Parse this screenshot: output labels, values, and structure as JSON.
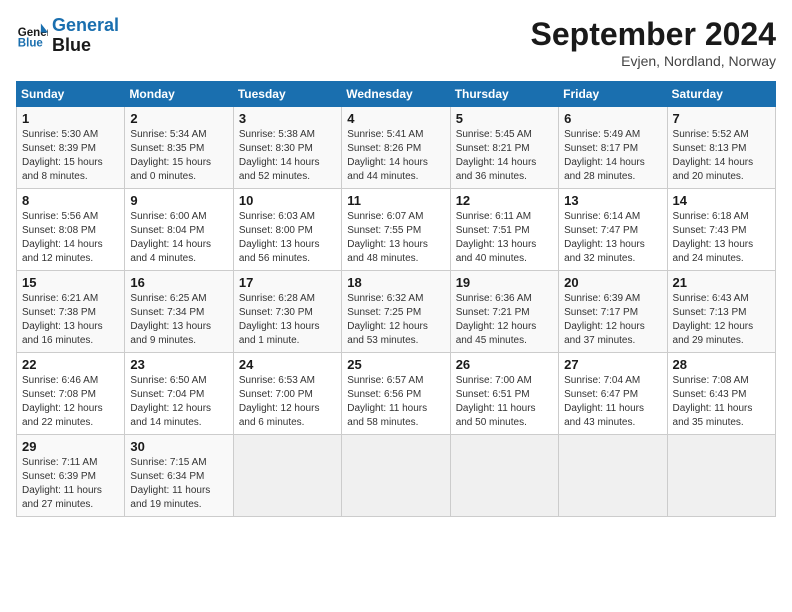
{
  "logo": {
    "line1": "General",
    "line2": "Blue"
  },
  "title": "September 2024",
  "subtitle": "Evjen, Nordland, Norway",
  "days_header": [
    "Sunday",
    "Monday",
    "Tuesday",
    "Wednesday",
    "Thursday",
    "Friday",
    "Saturday"
  ],
  "weeks": [
    [
      {
        "day": "1",
        "info": "Sunrise: 5:30 AM\nSunset: 8:39 PM\nDaylight: 15 hours\nand 8 minutes."
      },
      {
        "day": "2",
        "info": "Sunrise: 5:34 AM\nSunset: 8:35 PM\nDaylight: 15 hours\nand 0 minutes."
      },
      {
        "day": "3",
        "info": "Sunrise: 5:38 AM\nSunset: 8:30 PM\nDaylight: 14 hours\nand 52 minutes."
      },
      {
        "day": "4",
        "info": "Sunrise: 5:41 AM\nSunset: 8:26 PM\nDaylight: 14 hours\nand 44 minutes."
      },
      {
        "day": "5",
        "info": "Sunrise: 5:45 AM\nSunset: 8:21 PM\nDaylight: 14 hours\nand 36 minutes."
      },
      {
        "day": "6",
        "info": "Sunrise: 5:49 AM\nSunset: 8:17 PM\nDaylight: 14 hours\nand 28 minutes."
      },
      {
        "day": "7",
        "info": "Sunrise: 5:52 AM\nSunset: 8:13 PM\nDaylight: 14 hours\nand 20 minutes."
      }
    ],
    [
      {
        "day": "8",
        "info": "Sunrise: 5:56 AM\nSunset: 8:08 PM\nDaylight: 14 hours\nand 12 minutes."
      },
      {
        "day": "9",
        "info": "Sunrise: 6:00 AM\nSunset: 8:04 PM\nDaylight: 14 hours\nand 4 minutes."
      },
      {
        "day": "10",
        "info": "Sunrise: 6:03 AM\nSunset: 8:00 PM\nDaylight: 13 hours\nand 56 minutes."
      },
      {
        "day": "11",
        "info": "Sunrise: 6:07 AM\nSunset: 7:55 PM\nDaylight: 13 hours\nand 48 minutes."
      },
      {
        "day": "12",
        "info": "Sunrise: 6:11 AM\nSunset: 7:51 PM\nDaylight: 13 hours\nand 40 minutes."
      },
      {
        "day": "13",
        "info": "Sunrise: 6:14 AM\nSunset: 7:47 PM\nDaylight: 13 hours\nand 32 minutes."
      },
      {
        "day": "14",
        "info": "Sunrise: 6:18 AM\nSunset: 7:43 PM\nDaylight: 13 hours\nand 24 minutes."
      }
    ],
    [
      {
        "day": "15",
        "info": "Sunrise: 6:21 AM\nSunset: 7:38 PM\nDaylight: 13 hours\nand 16 minutes."
      },
      {
        "day": "16",
        "info": "Sunrise: 6:25 AM\nSunset: 7:34 PM\nDaylight: 13 hours\nand 9 minutes."
      },
      {
        "day": "17",
        "info": "Sunrise: 6:28 AM\nSunset: 7:30 PM\nDaylight: 13 hours\nand 1 minute."
      },
      {
        "day": "18",
        "info": "Sunrise: 6:32 AM\nSunset: 7:25 PM\nDaylight: 12 hours\nand 53 minutes."
      },
      {
        "day": "19",
        "info": "Sunrise: 6:36 AM\nSunset: 7:21 PM\nDaylight: 12 hours\nand 45 minutes."
      },
      {
        "day": "20",
        "info": "Sunrise: 6:39 AM\nSunset: 7:17 PM\nDaylight: 12 hours\nand 37 minutes."
      },
      {
        "day": "21",
        "info": "Sunrise: 6:43 AM\nSunset: 7:13 PM\nDaylight: 12 hours\nand 29 minutes."
      }
    ],
    [
      {
        "day": "22",
        "info": "Sunrise: 6:46 AM\nSunset: 7:08 PM\nDaylight: 12 hours\nand 22 minutes."
      },
      {
        "day": "23",
        "info": "Sunrise: 6:50 AM\nSunset: 7:04 PM\nDaylight: 12 hours\nand 14 minutes."
      },
      {
        "day": "24",
        "info": "Sunrise: 6:53 AM\nSunset: 7:00 PM\nDaylight: 12 hours\nand 6 minutes."
      },
      {
        "day": "25",
        "info": "Sunrise: 6:57 AM\nSunset: 6:56 PM\nDaylight: 11 hours\nand 58 minutes."
      },
      {
        "day": "26",
        "info": "Sunrise: 7:00 AM\nSunset: 6:51 PM\nDaylight: 11 hours\nand 50 minutes."
      },
      {
        "day": "27",
        "info": "Sunrise: 7:04 AM\nSunset: 6:47 PM\nDaylight: 11 hours\nand 43 minutes."
      },
      {
        "day": "28",
        "info": "Sunrise: 7:08 AM\nSunset: 6:43 PM\nDaylight: 11 hours\nand 35 minutes."
      }
    ],
    [
      {
        "day": "29",
        "info": "Sunrise: 7:11 AM\nSunset: 6:39 PM\nDaylight: 11 hours\nand 27 minutes."
      },
      {
        "day": "30",
        "info": "Sunrise: 7:15 AM\nSunset: 6:34 PM\nDaylight: 11 hours\nand 19 minutes."
      },
      {
        "day": "",
        "info": ""
      },
      {
        "day": "",
        "info": ""
      },
      {
        "day": "",
        "info": ""
      },
      {
        "day": "",
        "info": ""
      },
      {
        "day": "",
        "info": ""
      }
    ]
  ]
}
